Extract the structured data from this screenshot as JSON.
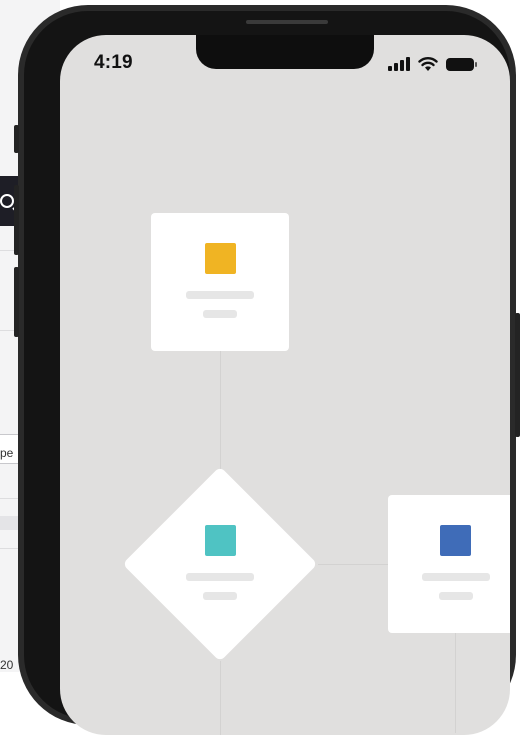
{
  "status_bar": {
    "time": "4:19"
  },
  "background_app": {
    "field_text_fragment": "pe",
    "footer_text_fragment": "20"
  },
  "flow": {
    "nodes": [
      {
        "shape": "card",
        "accent": "#F0B423"
      },
      {
        "shape": "diamond",
        "accent": "#4FC3C3"
      },
      {
        "shape": "card",
        "accent": "#3F6CB8"
      }
    ]
  },
  "colors": {
    "screen_background": "#E0DFDE",
    "phone_frame": "#2A2A2A",
    "node_background": "#FFFFFF"
  }
}
